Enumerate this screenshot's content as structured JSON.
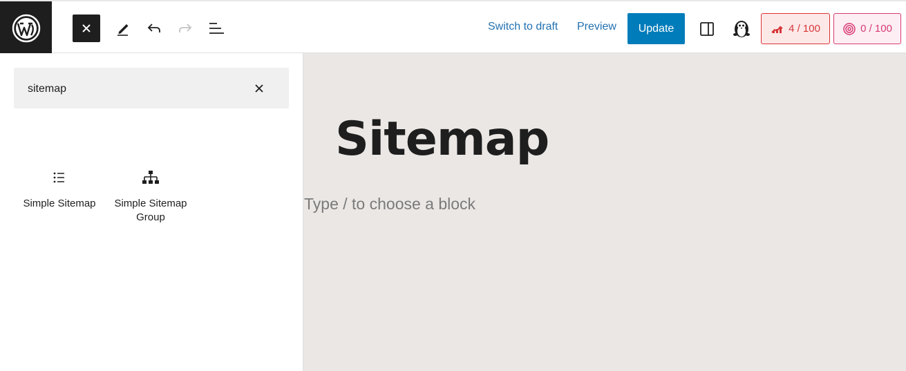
{
  "toolbar": {
    "switch_to_draft": "Switch to draft",
    "preview": "Preview",
    "update": "Update",
    "seo_score": "4 / 100",
    "content_score": "0 / 100"
  },
  "inserter": {
    "search_value": "sitemap",
    "results": [
      {
        "label": "Simple Sitemap",
        "icon": "list-icon"
      },
      {
        "label": "Simple Sitemap Group",
        "icon": "sitemap-hierarchy-icon"
      }
    ]
  },
  "editor": {
    "title": "Sitemap",
    "placeholder": "Type / to choose a block"
  },
  "colors": {
    "accent": "#007cba",
    "link": "#2271b1",
    "seo_red": "#d63638",
    "content_pink": "#d63a75",
    "canvas_bg": "#ebe7e5"
  }
}
